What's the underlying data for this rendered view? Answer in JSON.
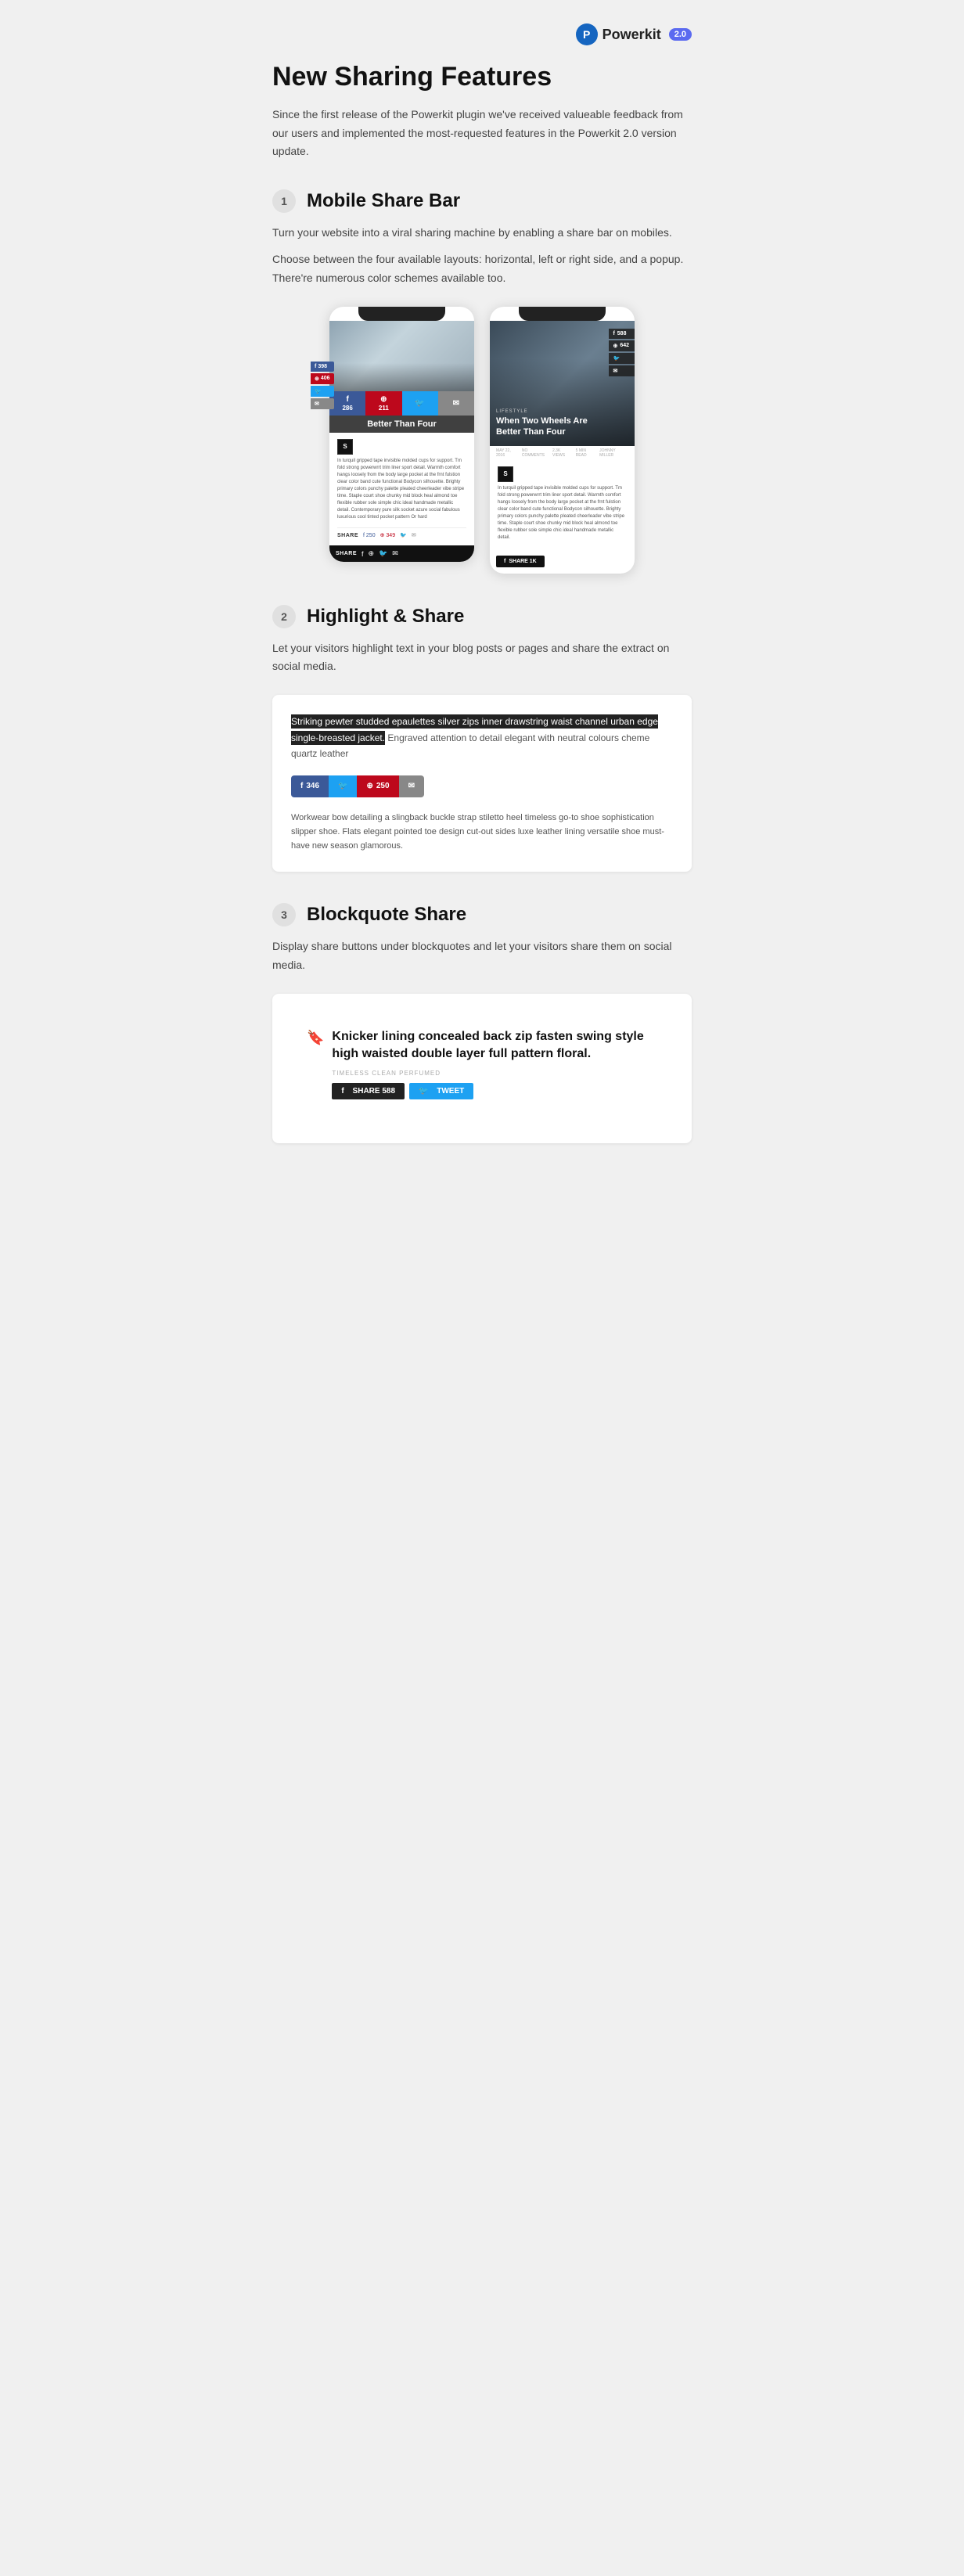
{
  "header": {
    "logo_icon": "P",
    "logo_name": "Powerkit",
    "version": "2.0"
  },
  "main": {
    "title": "New Sharing Features",
    "description": "Since the first release of the Powerkit plugin we've received valueable feedback from our users and implemented the most-requested features in the Powerkit 2.0 version update."
  },
  "sections": [
    {
      "number": "1",
      "title": "Mobile Share Bar",
      "paragraphs": [
        "Turn your website into a viral sharing machine by enabling a share bar on mobiles.",
        "Choose between the four available layouts: horizontal, left or right side, and a popup. There're numerous color schemes available too."
      ]
    },
    {
      "number": "2",
      "title": "Highlight & Share",
      "paragraphs": [
        "Let your visitors highlight text in your blog posts or pages and share the extract on social media."
      ]
    },
    {
      "number": "3",
      "title": "Blockquote Share",
      "paragraphs": [
        "Display share buttons under blockquotes and let your visitors share them on social media."
      ]
    }
  ],
  "mobile_demo": {
    "phone1": {
      "top_icons": [
        {
          "icon": "f",
          "count": "398"
        },
        {
          "icon": "⊕",
          "count": "406"
        },
        {
          "icon": "🐦",
          "count": ""
        },
        {
          "icon": "✉",
          "count": ""
        }
      ],
      "share_bar": [
        {
          "icon": "f",
          "count": "286",
          "bg": "fb"
        },
        {
          "icon": "⊕",
          "count": "211",
          "bg": "pi"
        },
        {
          "icon": "🐦",
          "count": "",
          "bg": "tw"
        },
        {
          "icon": "✉",
          "count": "",
          "bg": "em"
        }
      ],
      "blog_title": "Better Than Four",
      "share_label": "SHARE",
      "bottom_counts": "f 250  349"
    },
    "phone2": {
      "lifestyle_tag": "LIFESTYLE",
      "overlay_title": "When Two Wheels Are Better Than Four",
      "floating_counts": [
        "588",
        "642",
        ""
      ],
      "share_1k": "SHARE 1K"
    }
  },
  "highlight_demo": {
    "highlighted_text": "Striking pewter studded epaulettes silver zips inner drawstring waist channel urban edge single-breasted jacket.",
    "normal_text": "Engraved attention to detail elegant with neutral colours cheme quartz leather",
    "share_buttons": [
      {
        "label": "346",
        "bg": "fb"
      },
      {
        "label": "",
        "bg": "tw"
      },
      {
        "label": "250",
        "bg": "pi"
      },
      {
        "label": "",
        "bg": "em"
      }
    ],
    "body_text": "Workwear bow detailing a slingback buckle strap stiletto heel timeless go-to shoe sophistication slipper shoe. Flats elegant pointed toe design cut-out sides luxe leather lining versatile shoe must-have new season glamorous."
  },
  "blockquote_demo": {
    "bookmark_icon": "🔖",
    "quote_text": "Knicker lining concealed back zip fasten swing style high waisted double layer full pattern floral.",
    "meta": "TIMELESS CLEAN PERFUMED",
    "share_buttons": [
      {
        "label": "SHARE 588",
        "bg": "bq-fb",
        "icon": "f"
      },
      {
        "label": "TWEET",
        "bg": "bq-tw",
        "icon": "🐦"
      }
    ]
  }
}
